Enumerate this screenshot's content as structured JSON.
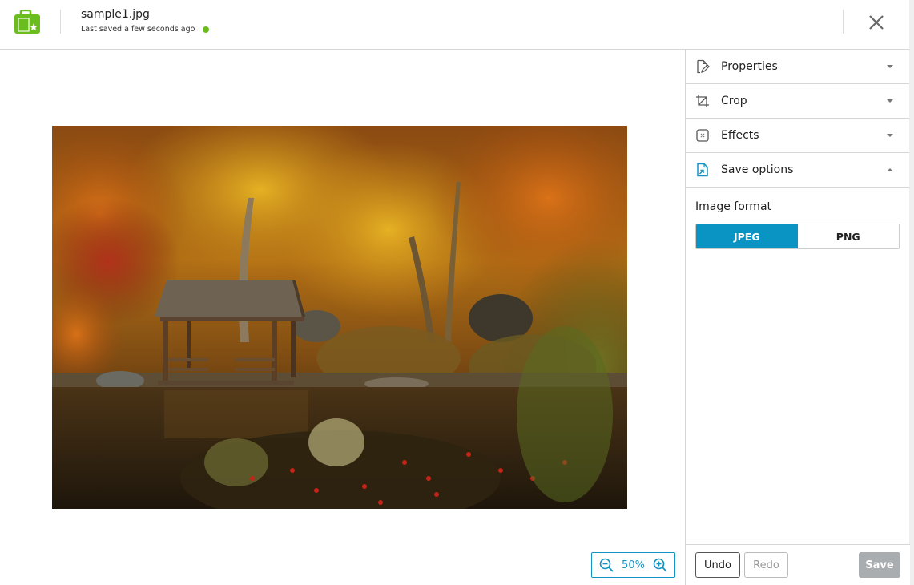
{
  "header": {
    "app_icon": "folder-star-icon",
    "file_name": "sample1.jpg",
    "save_status": "Last saved a few seconds ago",
    "status_color": "#6bbd1e",
    "close_icon": "close-icon"
  },
  "canvas": {
    "image_description": "Autumn forest with a wooden gazebo by a pond",
    "zoom": {
      "zoom_out_icon": "zoom-out-icon",
      "value": "50%",
      "zoom_in_icon": "zoom-in-icon"
    }
  },
  "side_panel": {
    "sections": [
      {
        "label": "Properties",
        "icon": "document-edit-icon",
        "expanded": false
      },
      {
        "label": "Crop",
        "icon": "crop-icon",
        "expanded": false
      },
      {
        "label": "Effects",
        "icon": "effects-icon",
        "expanded": false
      },
      {
        "label": "Save options",
        "icon": "save-options-icon",
        "expanded": true
      }
    ],
    "save_options": {
      "format_label": "Image format",
      "formats": [
        {
          "label": "JPEG",
          "selected": true
        },
        {
          "label": "PNG",
          "selected": false
        }
      ]
    },
    "footer": {
      "undo_label": "Undo",
      "redo_label": "Redo",
      "save_label": "Save"
    }
  },
  "colors": {
    "accent": "#0a94c4",
    "brand_green": "#6bbd1e",
    "disabled_button": "#a9adb0"
  }
}
